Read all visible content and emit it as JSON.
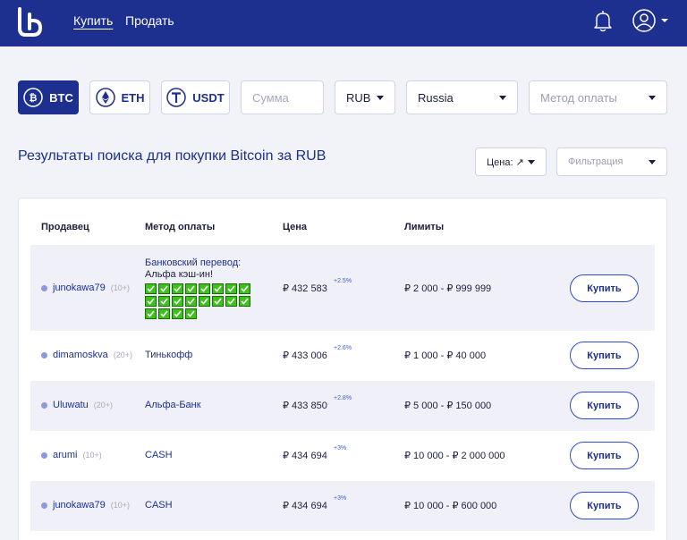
{
  "header": {
    "nav": {
      "buy": "Купить",
      "sell": "Продать"
    },
    "icons": {
      "logo": "lp-logo",
      "notifications": "bell-icon",
      "profile": "user-icon"
    },
    "colors": {
      "header_bg": "#1d2f8f",
      "accent": "#1d2f8f"
    }
  },
  "filters": {
    "crypto": [
      {
        "label": "BTC",
        "icon": "bitcoin-icon",
        "active": true
      },
      {
        "label": "ETH",
        "icon": "ethereum-icon",
        "active": false
      },
      {
        "label": "USDT",
        "icon": "tether-icon",
        "active": false
      }
    ],
    "amount_placeholder": "Сумма",
    "currency": "RUB",
    "country": "Russia",
    "payment_method_placeholder": "Метод оплаты"
  },
  "results": {
    "title": "Результаты поиска для покупки Bitcoin за RUB",
    "sort_label": "Цена: ↗",
    "filter_label": "Фильтрация"
  },
  "table": {
    "columns": {
      "seller": "Продавец",
      "method": "Метод оплаты",
      "price": "Цена",
      "limits": "Лимиты"
    },
    "buy_label": "Купить",
    "rows": [
      {
        "seller": "junokawa79",
        "count": "(10+)",
        "method_line1": "Банковский перевод:",
        "method_line2": "Альфа кэш-ин!",
        "checkmarks": 20,
        "price": "₽ 432 583",
        "delta": "+2.5%",
        "limits": "₽ 2 000 - ₽ 999 999"
      },
      {
        "seller": "dimamoskva",
        "count": "(20+)",
        "method": "Тинькофф",
        "price": "₽ 433 006",
        "delta": "+2.6%",
        "limits": "₽ 1 000 - ₽ 40 000"
      },
      {
        "seller": "Uluwatu",
        "count": "(20+)",
        "method": "Альфа-Банк",
        "price": "₽ 433 850",
        "delta": "+2.8%",
        "limits": "₽ 5 000 - ₽ 150 000"
      },
      {
        "seller": "arumi",
        "count": "(10+)",
        "method": "CASH",
        "price": "₽ 434 694",
        "delta": "+3%",
        "limits": "₽ 10 000 - ₽ 2 000 000"
      },
      {
        "seller": "junokawa79",
        "count": "(10+)",
        "method": "CASH",
        "price": "₽ 434 694",
        "delta": "+3%",
        "limits": "₽ 10 000 - ₽ 600 000"
      }
    ]
  }
}
